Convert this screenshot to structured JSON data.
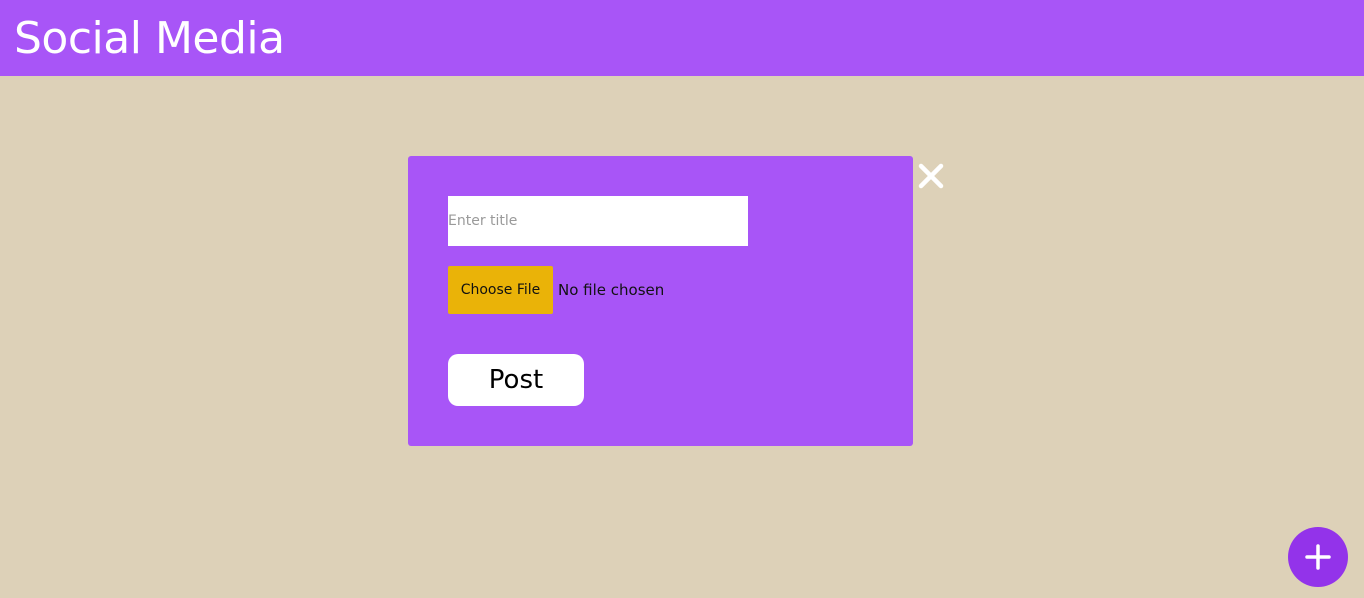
{
  "header": {
    "title": "Social Media"
  },
  "modal": {
    "title_input": {
      "placeholder": "Enter title",
      "value": ""
    },
    "file_picker": {
      "button_label": "Choose File",
      "status": "No file chosen"
    },
    "post_label": "Post",
    "close_icon": "close-icon"
  },
  "fab": {
    "icon": "plus-icon"
  },
  "colors": {
    "background": "#ddd1b8",
    "accent": "#a855f7",
    "fab": "#9333ea",
    "file_button": "#eab308"
  }
}
